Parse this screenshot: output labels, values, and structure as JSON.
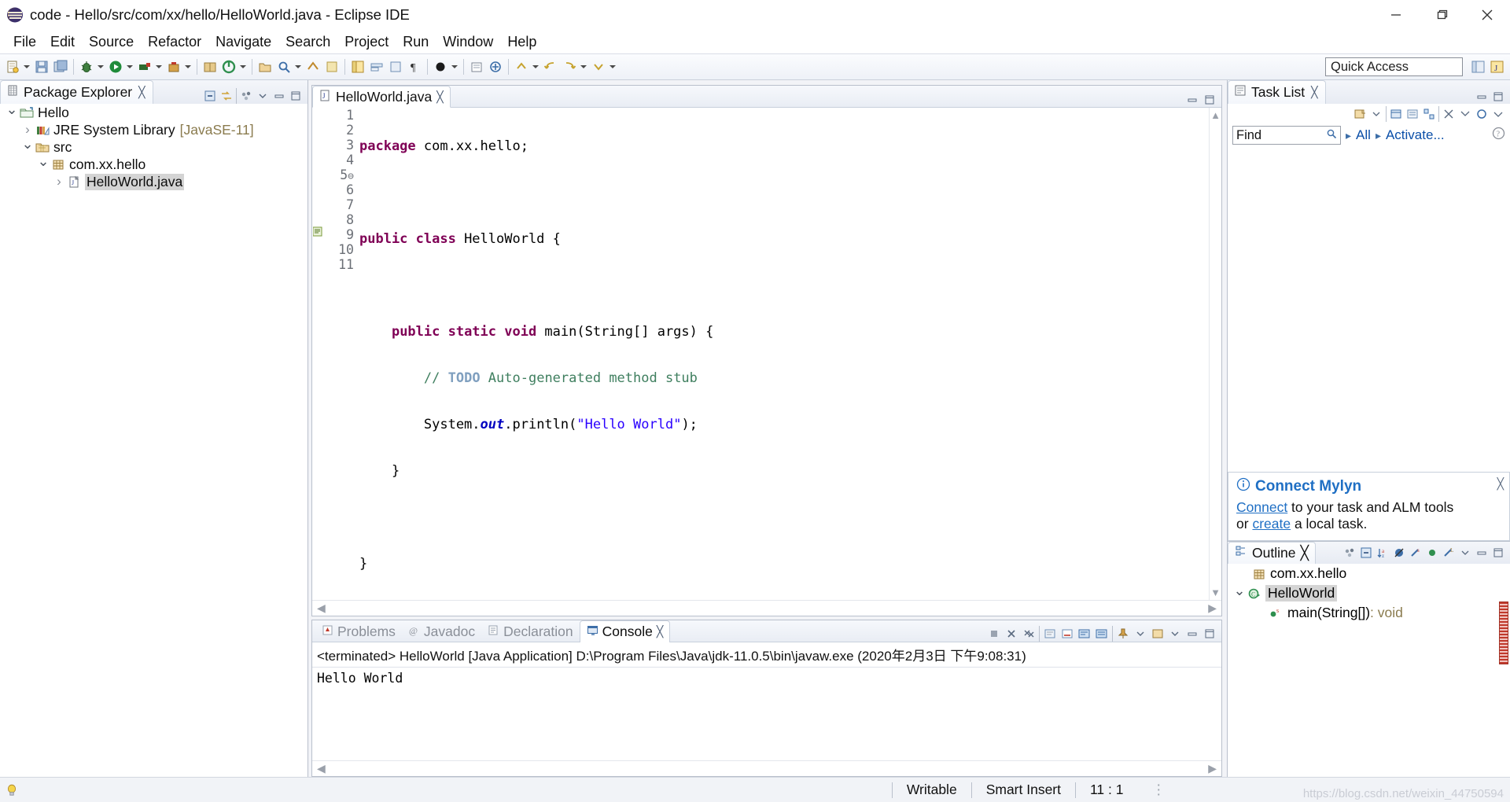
{
  "window": {
    "title": "code - Hello/src/com/xx/hello/HelloWorld.java - Eclipse IDE",
    "icon": "eclipse-icon",
    "minimize": "minimize-button",
    "maximize": "maximize-button",
    "close": "close-button"
  },
  "menubar": {
    "items": [
      "File",
      "Edit",
      "Source",
      "Refactor",
      "Navigate",
      "Search",
      "Project",
      "Run",
      "Window",
      "Help"
    ]
  },
  "toolbar": {
    "quick_access": "Quick Access"
  },
  "package_explorer": {
    "tab_label": "Package Explorer",
    "tree": [
      {
        "label": "Hello",
        "suffix": "",
        "depth": 0,
        "twisty": "open",
        "icon": "project-icon",
        "selected": false
      },
      {
        "label": "JRE System Library",
        "suffix": "[JavaSE-11]",
        "depth": 1,
        "twisty": "closed",
        "icon": "library-icon",
        "selected": false
      },
      {
        "label": "src",
        "suffix": "",
        "depth": 1,
        "twisty": "open",
        "icon": "source-folder-icon",
        "selected": false
      },
      {
        "label": "com.xx.hello",
        "suffix": "",
        "depth": 2,
        "twisty": "open",
        "icon": "package-icon",
        "selected": false
      },
      {
        "label": "HelloWorld.java",
        "suffix": "",
        "depth": 3,
        "twisty": "closed",
        "icon": "java-file-icon",
        "selected": true
      }
    ]
  },
  "editor": {
    "tab_label": "HelloWorld.java",
    "lines": [
      {
        "num": "1",
        "fold": "",
        "segs": [
          {
            "t": "package ",
            "c": "kw"
          },
          {
            "t": "com.xx.hello;",
            "c": "plain"
          }
        ]
      },
      {
        "num": "2",
        "fold": "",
        "segs": []
      },
      {
        "num": "3",
        "fold": "",
        "segs": [
          {
            "t": "public class ",
            "c": "kw"
          },
          {
            "t": "HelloWorld {",
            "c": "plain"
          }
        ]
      },
      {
        "num": "4",
        "fold": "",
        "segs": []
      },
      {
        "num": "5",
        "fold": "-",
        "segs": [
          {
            "t": "    ",
            "c": "plain"
          },
          {
            "t": "public static void ",
            "c": "kw"
          },
          {
            "t": "main(String[] args) {",
            "c": "plain"
          }
        ]
      },
      {
        "num": "6",
        "fold": "",
        "segs": [
          {
            "t": "        ",
            "c": "plain"
          },
          {
            "t": "// ",
            "c": "cmt"
          },
          {
            "t": "TODO",
            "c": "todo"
          },
          {
            "t": " Auto-generated method stub",
            "c": "cmt"
          }
        ]
      },
      {
        "num": "7",
        "fold": "",
        "segs": [
          {
            "t": "        System.",
            "c": "plain"
          },
          {
            "t": "out",
            "c": "fld"
          },
          {
            "t": ".println(",
            "c": "plain"
          },
          {
            "t": "\"Hello World\"",
            "c": "str"
          },
          {
            "t": ");",
            "c": "plain"
          }
        ]
      },
      {
        "num": "8",
        "fold": "",
        "segs": [
          {
            "t": "    }",
            "c": "plain"
          }
        ]
      },
      {
        "num": "9",
        "fold": "",
        "segs": []
      },
      {
        "num": "10",
        "fold": "",
        "segs": [
          {
            "t": "}",
            "c": "plain"
          }
        ]
      },
      {
        "num": "11",
        "fold": "",
        "segs": [],
        "cursor": true
      }
    ]
  },
  "console_panel": {
    "tabs": [
      {
        "label": "Problems",
        "icon": "problems-icon",
        "active": false
      },
      {
        "label": "Javadoc",
        "icon": "javadoc-icon",
        "active": false
      },
      {
        "label": "Declaration",
        "icon": "declaration-icon",
        "active": false
      },
      {
        "label": "Console",
        "icon": "console-icon",
        "active": true
      }
    ],
    "header": "<terminated> HelloWorld [Java Application] D:\\Program Files\\Java\\jdk-11.0.5\\bin\\javaw.exe (2020年2月3日 下午9:08:31)",
    "output": "Hello World"
  },
  "task_list": {
    "tab_label": "Task List",
    "find_placeholder": "Find",
    "all_label": "All",
    "activate_label": "Activate..."
  },
  "mylyn": {
    "title": "Connect Mylyn",
    "line1_link": "Connect",
    "line1_rest": " to your task and ALM tools",
    "line2_pre": "or ",
    "line2_link": "create",
    "line2_rest": " a local task."
  },
  "outline": {
    "tab_label": "Outline",
    "rows": [
      {
        "label": "com.xx.hello",
        "suffix": "",
        "depth": 1,
        "twisty": "none",
        "icon": "package-icon",
        "selected": false
      },
      {
        "label": "HelloWorld",
        "suffix": "",
        "depth": 0,
        "twisty": "open",
        "icon": "class-icon",
        "selected": true
      },
      {
        "label": "main(String[])",
        "suffix": " : void",
        "depth": 2,
        "twisty": "none",
        "icon": "method-public-static-icon",
        "selected": false
      }
    ]
  },
  "statusbar": {
    "writable": "Writable",
    "insert_mode": "Smart Insert",
    "position": "11 : 1",
    "watermark": "https://blog.csdn.net/weixin_44750594"
  },
  "colors": {
    "keyword": "#7f0055",
    "comment": "#3f7f5f",
    "string": "#2a00ff",
    "field": "#0000c0",
    "link": "#1f6fc4",
    "selection": "#d4d4d4"
  }
}
